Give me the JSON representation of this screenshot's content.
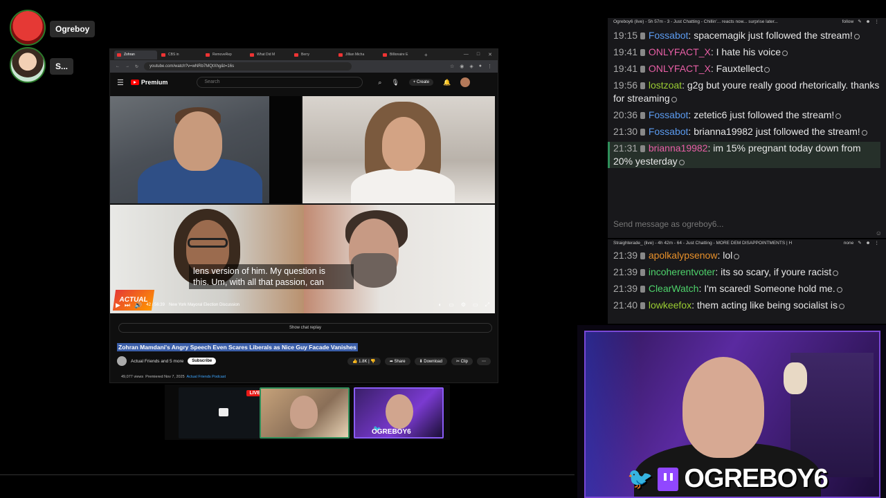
{
  "overlay": {
    "users": [
      {
        "name": "Ogreboy"
      },
      {
        "name": "S..."
      }
    ]
  },
  "browser": {
    "tabs": [
      "Zohran",
      "CBS in",
      "RemoveRep",
      "What Did M",
      "Berry",
      "Jillian Micha",
      "Billionaire E"
    ],
    "url": "youtube.com/watch?v=wNRb7MQtXhg&t=16s"
  },
  "youtube": {
    "logo_text": "Premium",
    "search_placeholder": "Search",
    "create_label": "Create",
    "caption_line1": "lens version of him. My question is",
    "caption_line2": "this. Um, with all that passion, can",
    "time": "42 / 56:39",
    "chapter": "New York Mayoral Election Discussion",
    "progress_fraction": 0.01,
    "show_chat_replay": "Show chat replay",
    "title": "Zohran Mamdani's Angry Speech Even Scares Liberals as Nice Guy Facade Vanishes",
    "channel": "Actual Friends and 5 more",
    "subscribe": "Subscribe",
    "likes": "1.8K",
    "share": "Share",
    "download": "Download",
    "clip": "Clip",
    "views": "49,077 views",
    "premiered": "Premiered Nov 7, 2025",
    "channel_tag": "Actual Friends Podcast"
  },
  "thumbnails": {
    "live_badge": "LIVE",
    "streamer_label": "OGREBOY6"
  },
  "chat1": {
    "header": "Ogreboy6 (live) - 5h 57m - 3 - Just Chatting - Chillin'... reacts now... surprise later...",
    "follow": "follow",
    "messages": [
      {
        "time": "19:15",
        "user": "Fossabot",
        "user_color": "#5b9bf0",
        "text": "spacemagik just followed the stream!"
      },
      {
        "time": "19:41",
        "user": "ONLYFACT_X",
        "user_color": "#e85fa6",
        "text": "I hate his voice"
      },
      {
        "time": "19:41",
        "user": "ONLYFACT_X",
        "user_color": "#e85fa6",
        "text": "Fauxtellect"
      },
      {
        "time": "19:56",
        "user": "lostzoat",
        "user_color": "#9acd32",
        "text": "g2g but youre really good rhetorically. thanks for streaming"
      },
      {
        "time": "20:36",
        "user": "Fossabot",
        "user_color": "#5b9bf0",
        "text": "zetetic6 just followed the stream!"
      },
      {
        "time": "21:30",
        "user": "Fossabot",
        "user_color": "#5b9bf0",
        "text": "brianna19982 just followed the stream!"
      },
      {
        "time": "21:31",
        "user": "brianna19982",
        "user_color": "#e85fa6",
        "text": "im 15% pregnant today down from 20% yesterday"
      }
    ],
    "send_placeholder": "Send message as ogreboy6..."
  },
  "chat2": {
    "header": "Straighterade_ (live) - 4h 42m - 64 - Just Chatting - MORE DEM DISAPPOINTMENTS | H",
    "status": "none",
    "messages": [
      {
        "time": "21:39",
        "user": "apolkalypsenow",
        "user_color": "#e8902a",
        "text": "lol"
      },
      {
        "time": "21:39",
        "user": "incoherentvoter",
        "user_color": "#4ed26b",
        "text": "its so scary, if youre racist"
      },
      {
        "time": "21:39",
        "user": "ClearWatch",
        "user_color": "#4ed26b",
        "text": "I'm scared! Someone hold me."
      },
      {
        "time": "21:40",
        "user": "lowkeefox",
        "user_color": "#9acd32",
        "text": "them acting like being socialist is"
      }
    ]
  },
  "webcam": {
    "streamer_name": "OGREBOY6"
  }
}
